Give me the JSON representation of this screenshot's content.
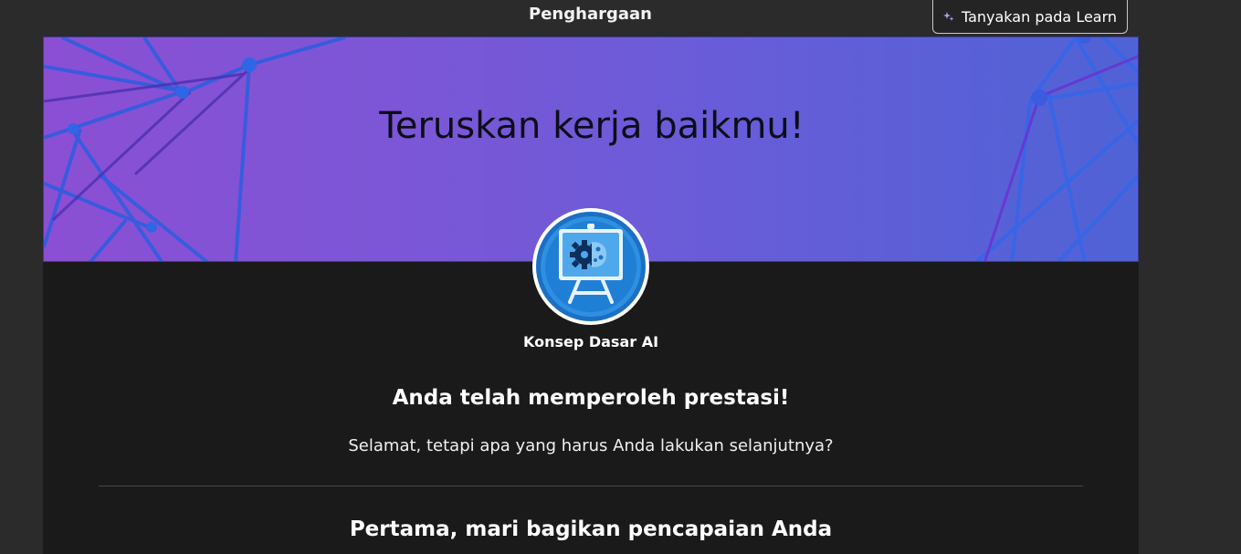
{
  "header": {
    "title": "Penghargaan",
    "ask_button_label": "Tanyakan pada Learn",
    "ask_icon": "sparkle-icon"
  },
  "banner": {
    "title": "Teruskan kerja baikmu!"
  },
  "badge": {
    "icon": "ai-presentation-badge",
    "label": "Konsep Dasar AI"
  },
  "achievement": {
    "heading": "Anda telah memperoleh prestasi!",
    "subtext": "Selamat, tetapi apa yang harus Anda lakukan selanjutnya?"
  },
  "share": {
    "heading": "Pertama, mari bagikan pencapaian Anda"
  },
  "colors": {
    "page_background": "#2b2b2b",
    "panel_background": "#1a1a1a",
    "banner_gradient_start": "#8b4fd4",
    "banner_gradient_end": "#4f63d6",
    "badge_blue": "#1f7fd4"
  }
}
